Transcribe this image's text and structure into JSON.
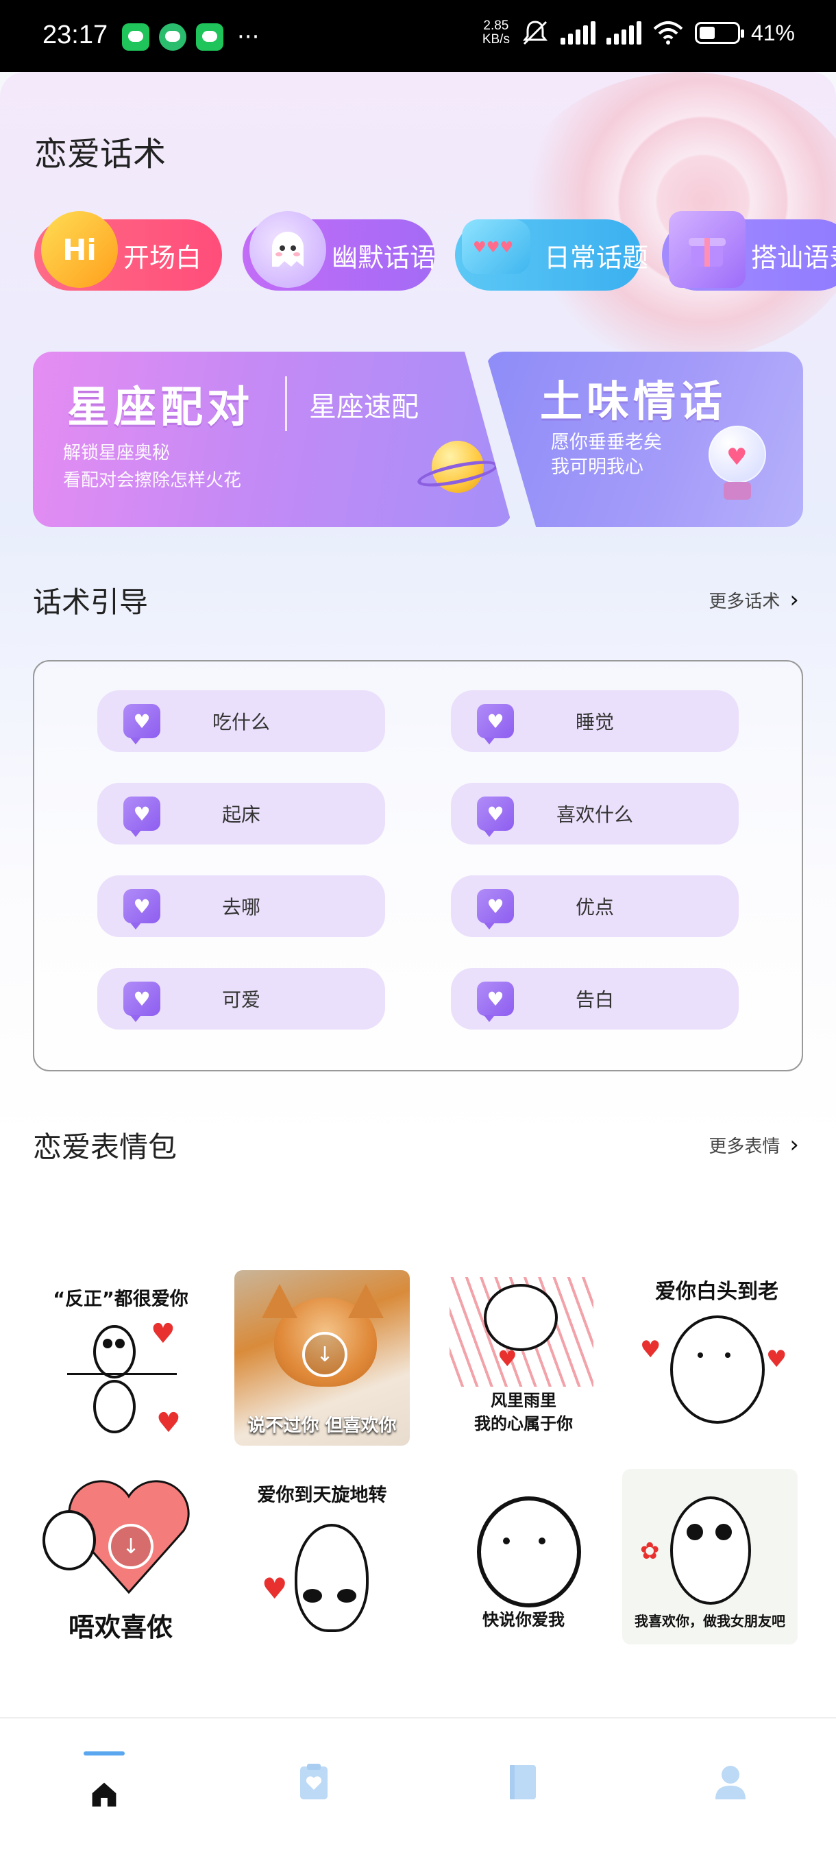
{
  "status_bar": {
    "time": "23:17",
    "net_speed_value": "2.85",
    "net_speed_unit": "KB/s",
    "battery": "41%",
    "more": "···"
  },
  "page": {
    "title": "恋爱话术"
  },
  "categories": [
    {
      "label": "开场白",
      "icon": "hi-icon",
      "icon_text": "Hi"
    },
    {
      "label": "幽默话语",
      "icon": "ghost-icon"
    },
    {
      "label": "日常话题",
      "icon": "chat-bubble-icon"
    },
    {
      "label": "搭讪语录",
      "icon": "gift-box-icon"
    }
  ],
  "banners": {
    "left": {
      "title": "星座配对",
      "subtitle": "星座速配",
      "desc_line1": "解锁星座奥秘",
      "desc_line2": "看配对会擦除怎样火花"
    },
    "right": {
      "title": "土味情话",
      "desc_line1": "愿你垂垂老矣",
      "desc_line2": "我可明我心"
    }
  },
  "guide": {
    "title": "话术引导",
    "more": "更多话术",
    "items": [
      "吃什么",
      "睡觉",
      "起床",
      "喜欢什么",
      "去哪",
      "优点",
      "可爱",
      "告白"
    ]
  },
  "stickers": {
    "title": "恋爱表情包",
    "more": "更多表情",
    "captions": [
      "“反正”都很爱你",
      "说不过你 但喜欢你",
      "风里雨里",
      "我的心属于你",
      "爱你白头到老",
      "唔欢喜侬",
      "爱你到天旋地转",
      "快说你爱我",
      "我喜欢你，做我女朋友吧"
    ]
  },
  "tabbar": {
    "tabs": [
      {
        "name": "home",
        "icon": "home-icon",
        "active": true
      },
      {
        "name": "clipboard",
        "icon": "heart-clipboard-icon",
        "active": false
      },
      {
        "name": "book",
        "icon": "book-icon",
        "active": false
      },
      {
        "name": "profile",
        "icon": "person-icon",
        "active": false
      }
    ],
    "accent": "#5aa7f0",
    "inactive": "#bcd9f5"
  }
}
